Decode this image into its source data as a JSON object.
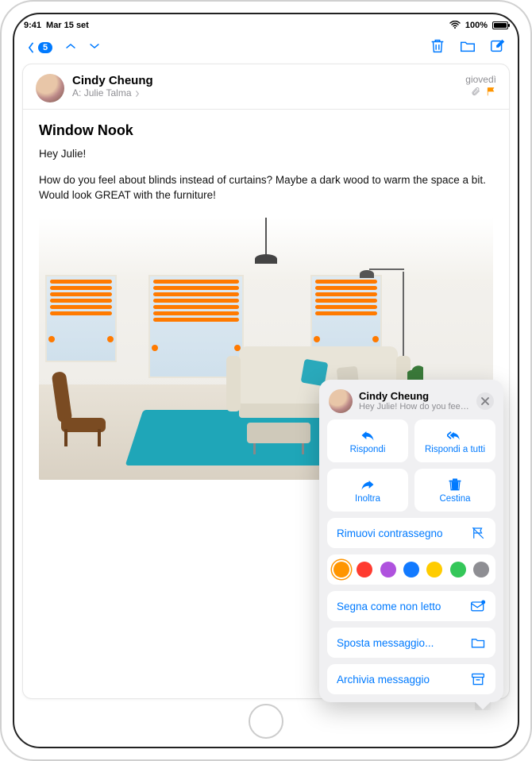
{
  "status_bar": {
    "time": "9:41",
    "date": "Mar 15 set",
    "battery_pct": "100%"
  },
  "toolbar": {
    "unread_count": "5"
  },
  "message": {
    "from_name": "Cindy Cheung",
    "to_prefix": "A:",
    "to_name": "Julie Talma",
    "day_label": "giovedì",
    "subject": "Window Nook",
    "greeting": "Hey Julie!",
    "body": "How do you feel about blinds instead of curtains? Maybe a dark wood to warm the space a bit. Would look GREAT with the furniture!"
  },
  "sheet": {
    "name": "Cindy Cheung",
    "preview": "Hey Julie! How do you feel ab...",
    "reply": "Rispondi",
    "reply_all": "Rispondi a tutti",
    "forward": "Inoltra",
    "trash": "Cestina",
    "remove_flag": "Rimuovi contrassegno",
    "mark_unread": "Segna come non letto",
    "move_message": "Sposta messaggio...",
    "archive_message": "Archivia messaggio",
    "flag_colors": [
      "#ff9500",
      "#ff3b30",
      "#af52de",
      "#127aff",
      "#ffcc00",
      "#34c759",
      "#8e8e93"
    ]
  }
}
